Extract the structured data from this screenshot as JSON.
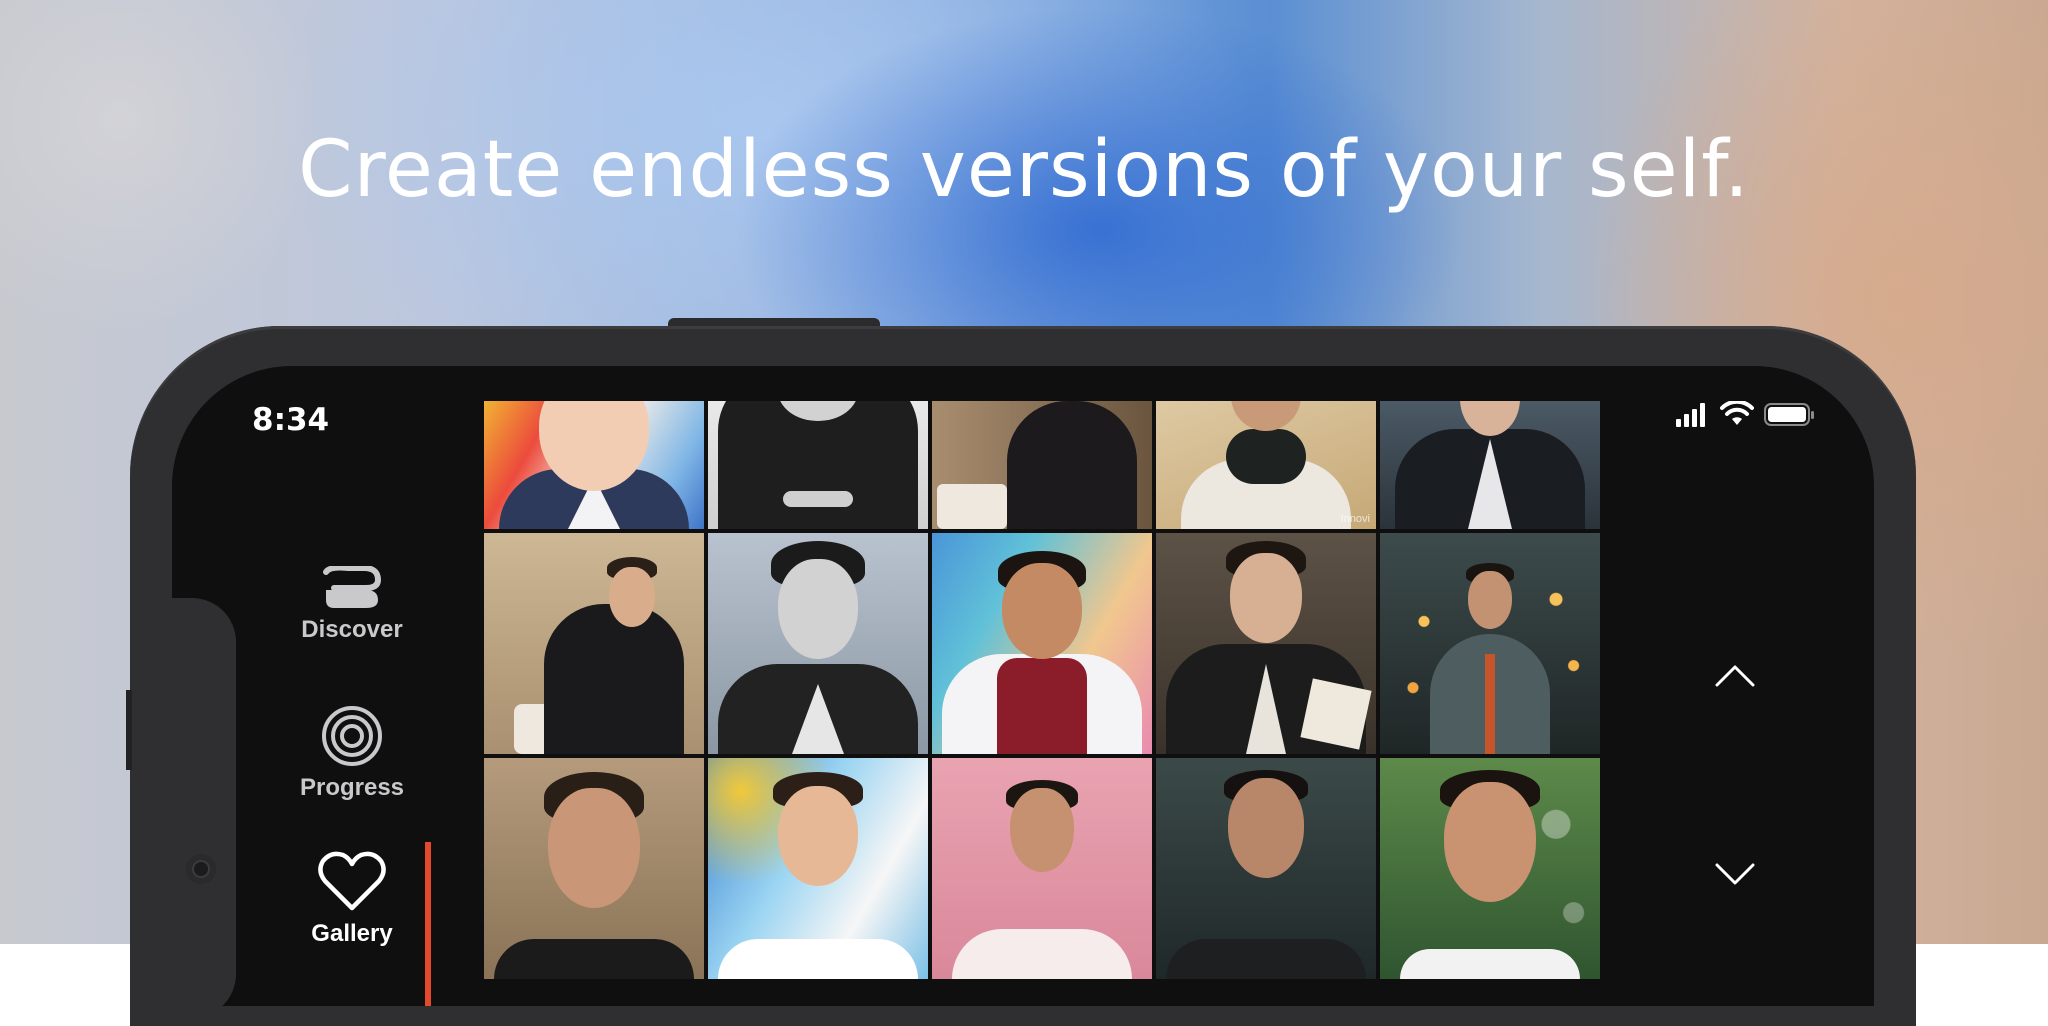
{
  "headline": "Create endless versions of your self.",
  "status_bar": {
    "time": "8:34",
    "icons": [
      "signal-icon",
      "wifi-icon",
      "battery-icon"
    ]
  },
  "nav": {
    "items": [
      {
        "label": "Discover",
        "icon": "discover-icon",
        "active": false
      },
      {
        "label": "Progress",
        "icon": "progress-icon",
        "active": false
      },
      {
        "label": "Gallery",
        "icon": "heart-icon",
        "active": true
      }
    ],
    "accent_color": "#e24a2b"
  },
  "gallery": {
    "tiles": [
      {
        "style": "watercolor-portrait",
        "watermark": ""
      },
      {
        "style": "black-white-suit",
        "watermark": ""
      },
      {
        "style": "sepia-cafe-suit",
        "watermark": ""
      },
      {
        "style": "desert-scarf",
        "watermark": "Innovi"
      },
      {
        "style": "dark-forest-suit",
        "watermark": ""
      },
      {
        "style": "cafe-suit-seated",
        "watermark": ""
      },
      {
        "style": "bw-vintage-portrait",
        "watermark": ""
      },
      {
        "style": "rainbow-varsity-jacket",
        "watermark": ""
      },
      {
        "style": "vintage-oil-portrait",
        "watermark": ""
      },
      {
        "style": "city-bokeh-suit",
        "watermark": ""
      },
      {
        "style": "classic-oil-portrait",
        "watermark": ""
      },
      {
        "style": "watercolor-splash",
        "watermark": ""
      },
      {
        "style": "pink-studio",
        "watermark": ""
      },
      {
        "style": "dark-forest-jacket",
        "watermark": ""
      },
      {
        "style": "bubbles-smile",
        "watermark": ""
      }
    ]
  },
  "scroll_controls": {
    "up_icon": "chevron-up-icon",
    "down_icon": "chevron-down-icon"
  }
}
